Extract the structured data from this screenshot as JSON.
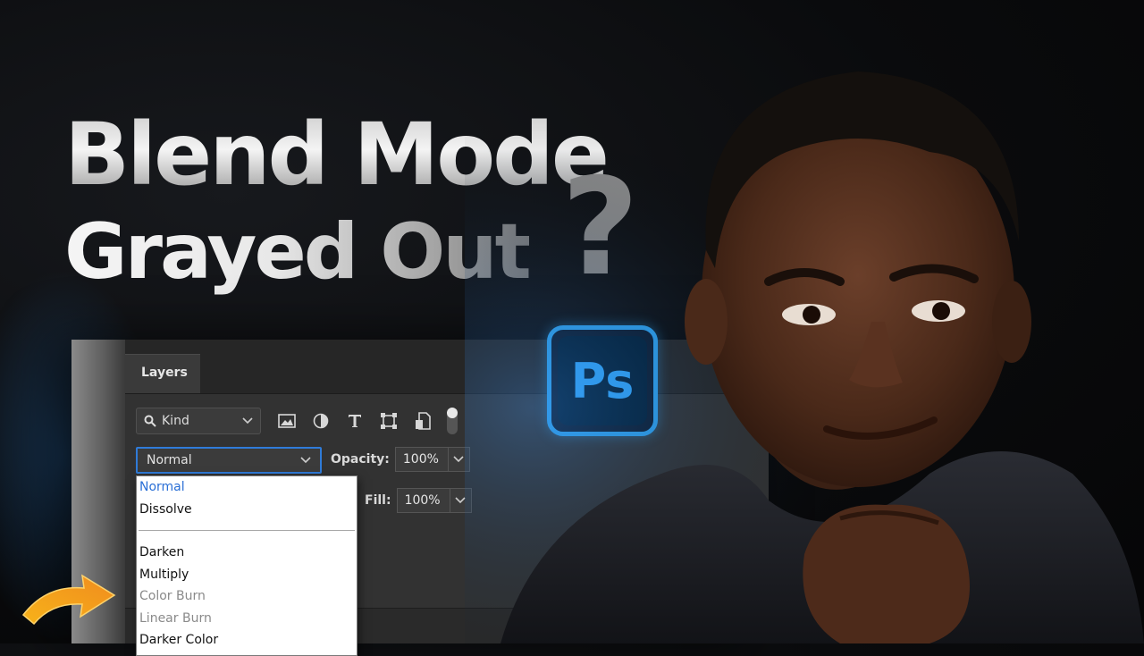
{
  "headline": {
    "line1": "Blend Mode",
    "line2": "Grayed Out",
    "question_mark": "?"
  },
  "panel": {
    "tab_label": "Layers",
    "filter": {
      "kind_label": "Kind",
      "search_icon": "search-icon",
      "chevron_icon": "chevron-down-icon",
      "icons": [
        "image-filter-icon",
        "adjustment-filter-icon",
        "type-filter-icon",
        "shape-filter-icon",
        "smart-object-filter-icon",
        "filter-toggle-icon"
      ]
    },
    "blend_mode": {
      "selected": "Normal"
    },
    "opacity": {
      "label": "Opacity:",
      "value": "100%"
    },
    "fill": {
      "label": "Fill:",
      "value": "100%"
    }
  },
  "dropdown": {
    "items": [
      {
        "label": "Normal",
        "state": "selected"
      },
      {
        "label": "Dissolve",
        "state": "enabled"
      },
      {
        "label": "",
        "state": "separator"
      },
      {
        "label": "Darken",
        "state": "enabled"
      },
      {
        "label": "Multiply",
        "state": "enabled"
      },
      {
        "label": "Color Burn",
        "state": "disabled"
      },
      {
        "label": "Linear Burn",
        "state": "disabled"
      },
      {
        "label": "Darker Color",
        "state": "enabled"
      }
    ]
  },
  "logo": {
    "text": "Ps",
    "accent": "#31a8ff"
  },
  "colors": {
    "selection_blue": "#2f7bd8",
    "arrow_orange": "#f5a623"
  }
}
